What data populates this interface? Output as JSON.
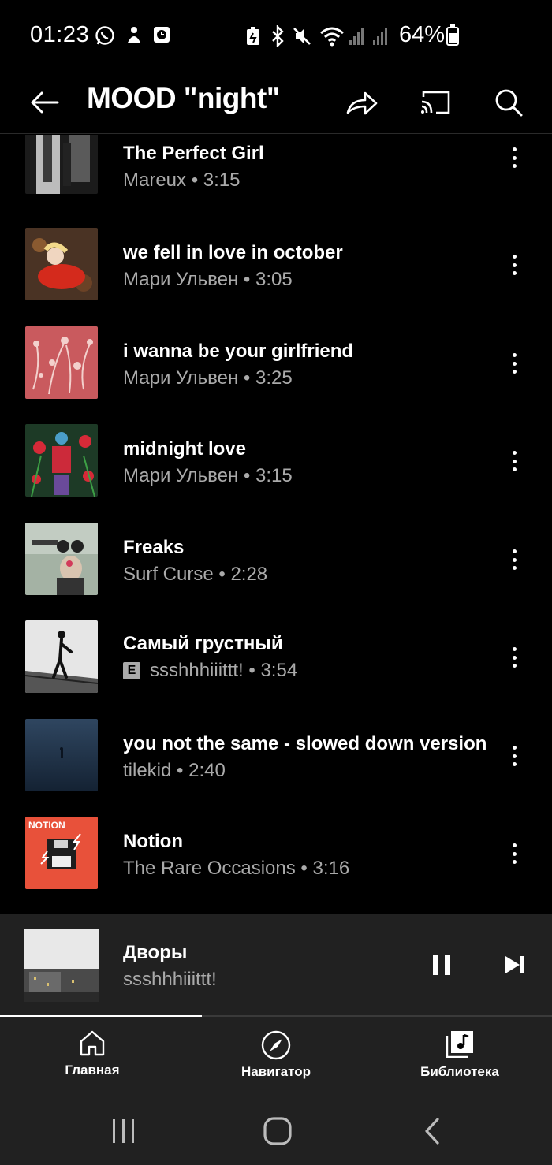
{
  "status_bar": {
    "time": "01:23",
    "battery": "64%",
    "battery_level": 0.64,
    "left_icons": [
      "whatsapp-icon",
      "notification-icon",
      "clock-icon"
    ],
    "right_icons": [
      "battery-saver-icon",
      "bluetooth-icon",
      "mute-icon",
      "wifi-icon",
      "signal-icon",
      "signal-icon"
    ]
  },
  "header": {
    "title": "MOOD \"night\"",
    "back_icon": "back-arrow-icon",
    "share_icon": "share-icon",
    "cast_icon": "cast-icon",
    "search_icon": "search-icon"
  },
  "tracks": [
    {
      "title": "The Perfect Girl",
      "subtitle": "Mareux • 3:15",
      "explicit": false,
      "art_colors": [
        "#1a1a1a",
        "#e8e8e8"
      ]
    },
    {
      "title": "we fell in love in october",
      "subtitle": "Мари Ульвен • 3:05",
      "explicit": false,
      "art_colors": [
        "#5a3a28",
        "#d62a1e"
      ]
    },
    {
      "title": "i wanna be your girlfriend",
      "subtitle": "Мари Ульвен • 3:25",
      "explicit": false,
      "art_colors": [
        "#c95a5e",
        "#f0c7c4"
      ]
    },
    {
      "title": "midnight love",
      "subtitle": "Мари Ульвен • 3:15",
      "explicit": false,
      "art_colors": [
        "#1e3a28",
        "#d62a38"
      ]
    },
    {
      "title": "Freaks",
      "subtitle": "Surf Curse • 2:28",
      "explicit": false,
      "art_colors": [
        "#9aa89a",
        "#3a3a3a"
      ]
    },
    {
      "title": "Самый грустный",
      "subtitle": "ssshhhiiittt! • 3:54",
      "explicit": true,
      "explicit_label": "E",
      "art_colors": [
        "#e8e8e8",
        "#111111"
      ]
    },
    {
      "title": "you not the same - slowed down version",
      "subtitle": "tilekid • 2:40",
      "explicit": false,
      "art_colors": [
        "#1c2d44",
        "#30455e"
      ]
    },
    {
      "title": "Notion",
      "subtitle": "The Rare Occasions • 3:16",
      "explicit": false,
      "art_text": "NOTION",
      "art_colors": [
        "#e8513a",
        "#222222"
      ]
    }
  ],
  "mini_player": {
    "title": "Дворы",
    "artist": "ssshhhiiittt!",
    "progress": 0.365,
    "pause_icon": "pause-icon",
    "next_icon": "skip-next-icon"
  },
  "bottom_nav": {
    "items": [
      {
        "label": "Главная",
        "icon": "home-icon"
      },
      {
        "label": "Навигатор",
        "icon": "compass-icon"
      },
      {
        "label": "Библиотека",
        "icon": "library-icon"
      }
    ]
  },
  "system_nav": {
    "icons": [
      "recents-icon",
      "home-circle-icon",
      "back-chevron-icon"
    ]
  }
}
